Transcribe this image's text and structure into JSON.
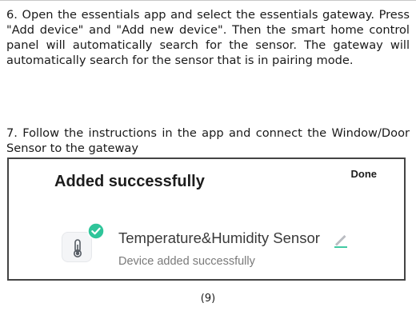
{
  "steps": [
    {
      "text": "6. Open the essentials app and select the essentials gateway. Press \"Add device\" and \"Add new device\".  Then the smart home control panel will automatically search for the sensor. The gateway will automatically search for the sensor that is in pairing mode."
    },
    {
      "text": "7. Follow the instructions in the app and connect the Window/Door Sensor to the gateway"
    }
  ],
  "screenshot": {
    "title": "Added successfully",
    "done_label": "Done",
    "device": {
      "name": "Temperature&Humidity Sensor",
      "status": "Device added successfully",
      "icon": "thermometer-icon",
      "badge_icon": "check-icon",
      "edit_icon": "pencil-icon"
    },
    "colors": {
      "accent": "#2fc59a",
      "edit_line": "#2fc59a",
      "icon_bg": "#f4f5f7"
    }
  },
  "page_number": "(9)"
}
